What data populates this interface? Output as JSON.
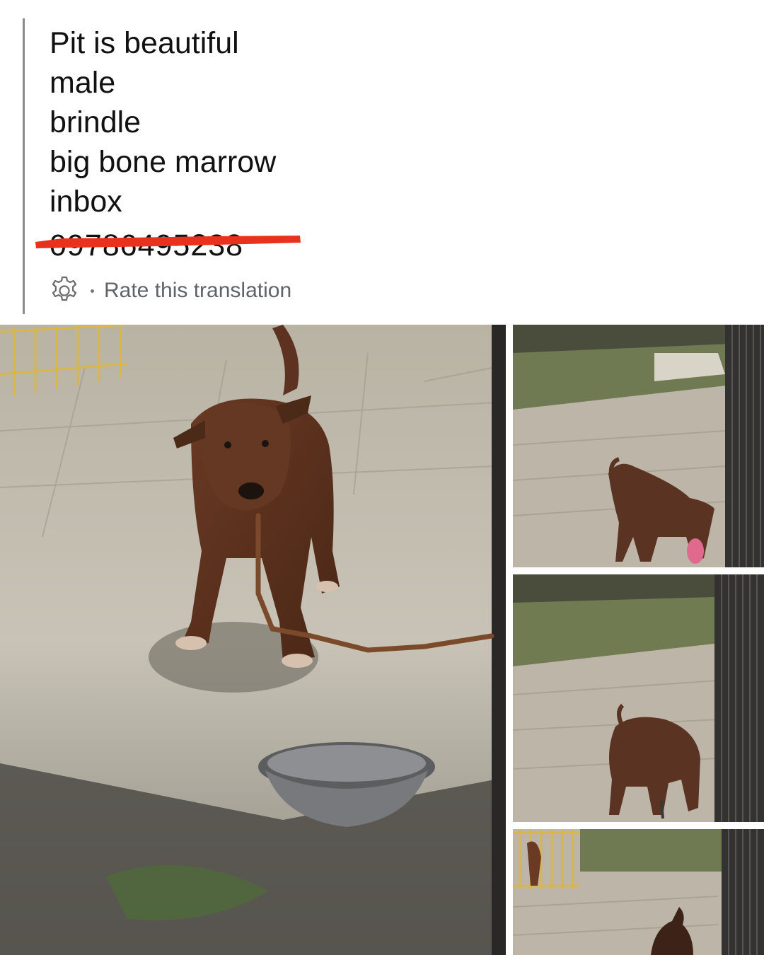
{
  "post": {
    "lines": [
      "Pit is beautiful",
      "male",
      "brindle",
      "big bone marrow",
      "inbox"
    ],
    "phone_redacted": "09786495238"
  },
  "translation": {
    "link_label": "Rate this translation",
    "icon": "gear-icon"
  },
  "colors": {
    "redact_red": "#e8321e",
    "quote_bar": "#8a8a8a",
    "link_gray": "#5f6368"
  },
  "photos": [
    {
      "icon": "photo-main",
      "subject": "brindle-puppy-chained"
    },
    {
      "icon": "photo-thumb",
      "subject": "puppy-walking"
    },
    {
      "icon": "photo-thumb",
      "subject": "puppy-standing"
    },
    {
      "icon": "photo-thumb",
      "subject": "yard-with-cage"
    }
  ]
}
